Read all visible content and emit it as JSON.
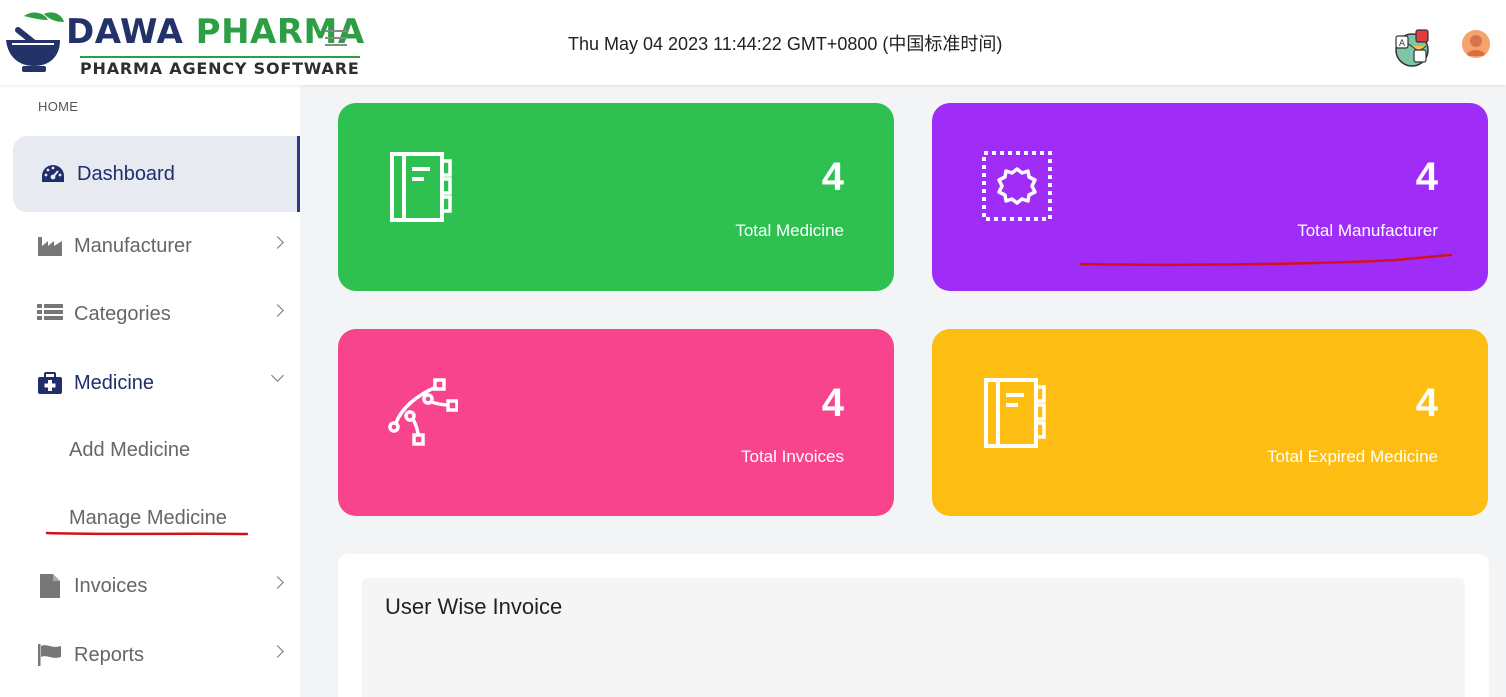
{
  "brand": {
    "name_part1": "DAWA",
    "name_part2": "PHARMA",
    "tagline": "PHARMA AGENCY SOFTWARE"
  },
  "header": {
    "datetime": "Thu May 04 2023 11:44:22 GMT+0800 (中国标准时间)"
  },
  "sidebar": {
    "section_label": "HOME",
    "items": [
      {
        "label": "Dashboard",
        "icon": "dashboard-gauge-icon",
        "active": true
      },
      {
        "label": "Manufacturer",
        "icon": "factory-icon"
      },
      {
        "label": "Categories",
        "icon": "list-icon"
      },
      {
        "label": "Medicine",
        "icon": "medical-kit-icon",
        "expanded": true
      },
      {
        "label": "Invoices",
        "icon": "file-icon"
      },
      {
        "label": "Reports",
        "icon": "flag-icon"
      }
    ],
    "medicine_subitems": [
      {
        "label": "Add Medicine"
      },
      {
        "label": "Manage Medicine"
      }
    ]
  },
  "cards": [
    {
      "value": "4",
      "label": "Total Medicine",
      "color": "#2ec152",
      "icon": "notebook-icon"
    },
    {
      "value": "4",
      "label": "Total Manufacturer",
      "color": "#9f2cf7",
      "icon": "gear-frame-icon"
    },
    {
      "value": "4",
      "label": "Total Invoices",
      "color": "#f7448c",
      "icon": "vector-pen-icon"
    },
    {
      "value": "4",
      "label": "Total Expired Medicine",
      "color": "#fdbd13",
      "icon": "notebook-icon"
    }
  ],
  "panel": {
    "title": "User Wise Invoice"
  },
  "colors": {
    "brand_navy": "#233269",
    "brand_green": "#2e9e44",
    "annotation_red": "#d0121b"
  }
}
